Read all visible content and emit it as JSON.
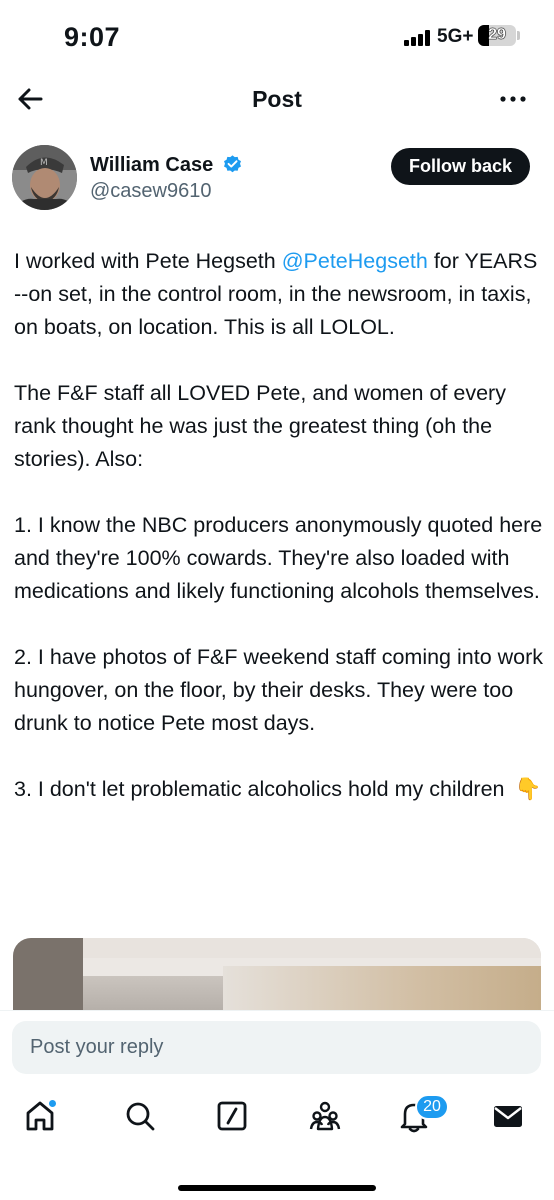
{
  "status_bar": {
    "time": "9:07",
    "network": "5G+",
    "battery_level": "29",
    "battery_fraction": 0.29
  },
  "header": {
    "title": "Post",
    "back_icon": "arrow-left-icon",
    "more_icon": "more-horizontal-icon"
  },
  "author": {
    "name": "William Case",
    "handle": "@casew9610",
    "verified_icon": "verified-badge-icon",
    "follow_label": "Follow back"
  },
  "post": {
    "p1_before": "I worked with Pete Hegseth ",
    "p1_mention": "@PeteHegseth",
    "p1_after": " for YEARS --on set, in the control room, in the newsroom, in taxis, on boats, on location. This is all LOLOL.",
    "p2": "The F&F staff all LOVED Pete, and women of every rank thought he was just the greatest thing (oh the stories). Also:",
    "p3": "1. I know the NBC producers anonymously quoted here and they're 100% cowards. They're also loaded with medications and likely functioning alcohols themselves.",
    "p4": "2. I have photos of F&F weekend staff coming into work hungover, on the floor, by their desks. They were too drunk to notice Pete most days.",
    "p5": "3. I don't let problematic alcoholics hold my children",
    "p5_emoji": "👇"
  },
  "reply": {
    "placeholder": "Post your reply"
  },
  "tab_bar": {
    "notifications_count": "20",
    "icons": [
      "home-icon",
      "search-icon",
      "grok-icon",
      "communities-icon",
      "notifications-icon",
      "messages-icon"
    ]
  },
  "colors": {
    "accent": "#1d9bf0",
    "text": "#0f1419",
    "secondary": "#536471"
  }
}
